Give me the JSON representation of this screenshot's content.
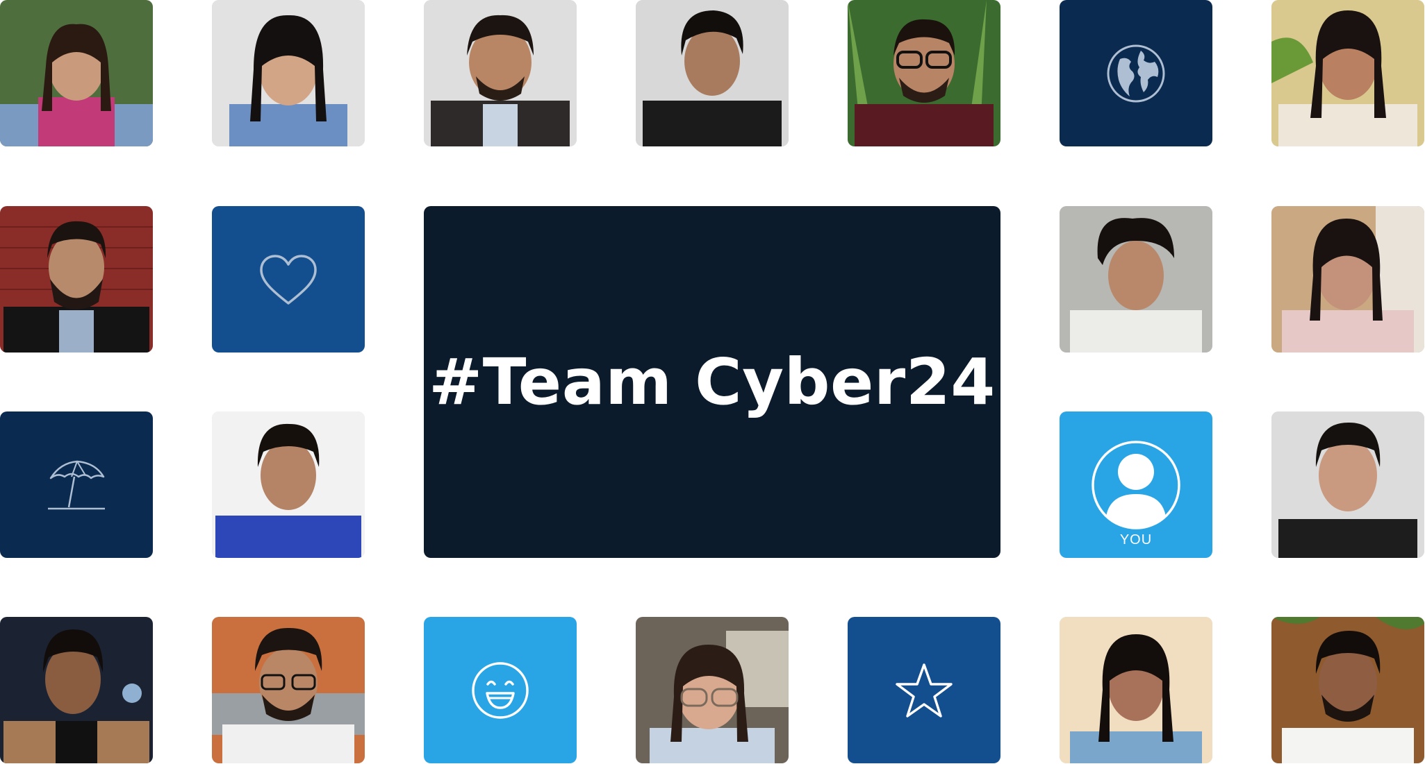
{
  "banner": {
    "title": "#Team Cyber24"
  },
  "you_tile": {
    "label": "YOU"
  },
  "colors": {
    "navy": "#0b2a4f",
    "royal": "#134f8e",
    "sky": "#29a5e6",
    "banner": "#0c1b2b"
  },
  "icons": [
    "globe-icon",
    "heart-icon",
    "beach-umbrella-icon",
    "user-profile-icon",
    "smiley-icon",
    "star-icon"
  ]
}
